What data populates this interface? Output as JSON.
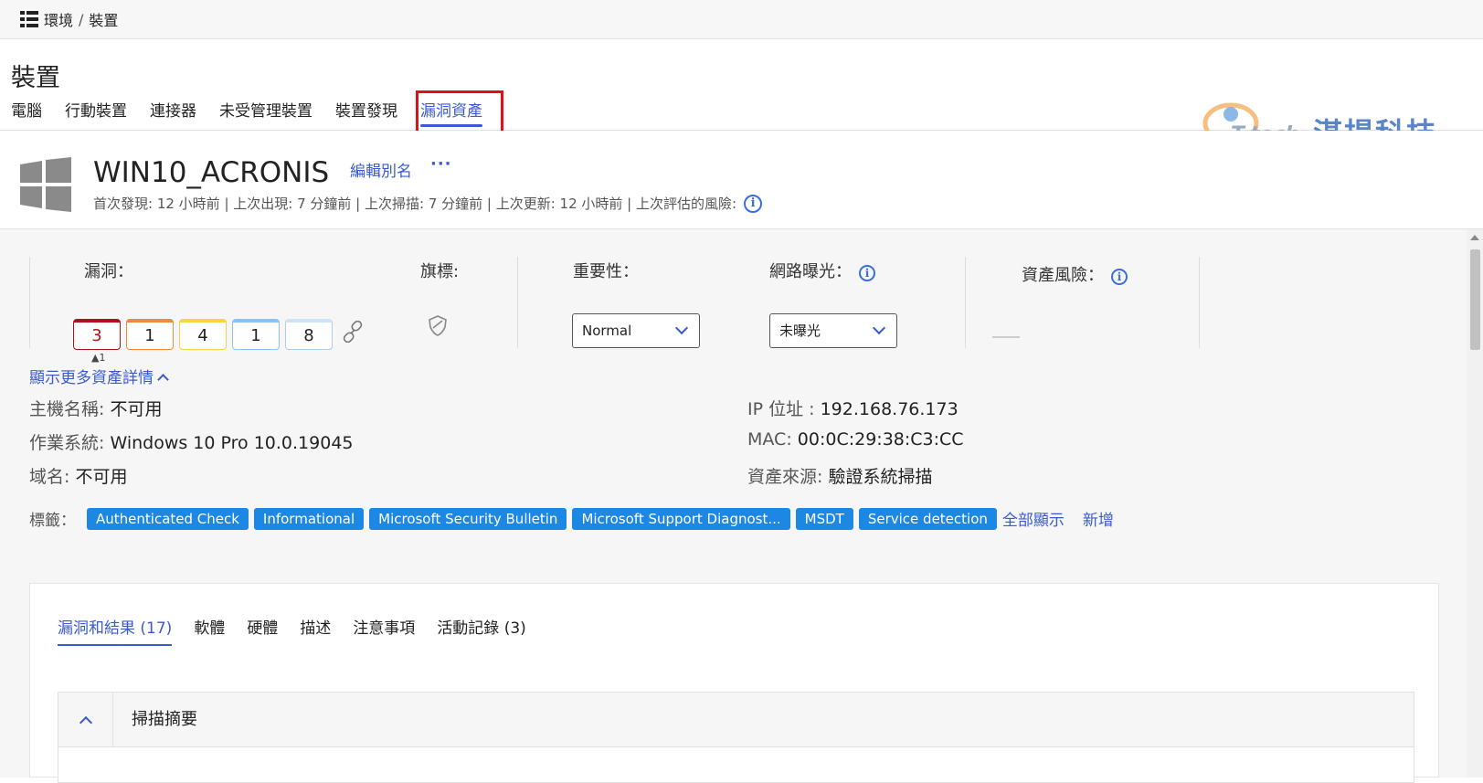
{
  "breadcrumb": {
    "root": "環境",
    "current": "裝置"
  },
  "page": {
    "title": "裝置"
  },
  "tabs": [
    {
      "label": "電腦"
    },
    {
      "label": "行動裝置"
    },
    {
      "label": "連接器"
    },
    {
      "label": "未受管理裝置"
    },
    {
      "label": "裝置發現"
    },
    {
      "label": "漏洞資產",
      "active": true
    }
  ],
  "logo": {
    "latin": "T-tech",
    "chinese": "湛揚科技"
  },
  "device": {
    "name": "WIN10_ACRONIS",
    "edit_alias": "編輯別名",
    "more": "···",
    "meta": "首次發現: 12 小時前 | 上次出現: 7 分鐘前 | 上次掃描: 7 分鐘前 | 上次更新: 12 小時前 | 上次評估的風險:"
  },
  "summary": {
    "vuln_label": "漏洞：",
    "severity_counts": {
      "s5": "3",
      "s4": "1",
      "s3": "4",
      "s2": "1",
      "s1": "8"
    },
    "trend": "▲1",
    "flags_label": "旗標:",
    "importance_label": "重要性：",
    "importance_value": "Normal",
    "exposure_label": "網路曝光：",
    "exposure_value": "未曝光",
    "risk_label": "資產風險："
  },
  "details": {
    "toggle": "顯示更多資產詳情",
    "hostname_key": "主機名稱:",
    "hostname_val": "不可用",
    "os_key": "作業系統:",
    "os_val": "Windows 10 Pro 10.0.19045",
    "domain_key": "域名:",
    "domain_val": "不可用",
    "ip_key": "IP 位址 :",
    "ip_val": "192.168.76.173",
    "mac_key": "MAC:",
    "mac_val": "00:0C:29:38:C3:CC",
    "source_key": "資產來源:",
    "source_val": "驗證系統掃描"
  },
  "tags": {
    "label": "標籤：",
    "items": [
      "Authenticated Check",
      "Informational",
      "Microsoft Security Bulletin",
      "Microsoft Support Diagnost...",
      "MSDT",
      "Service detection"
    ],
    "show_all": "全部顯示",
    "add": "新增"
  },
  "panel": {
    "tabs": [
      {
        "label": "漏洞和結果 (17)",
        "active": true
      },
      {
        "label": "軟體"
      },
      {
        "label": "硬體"
      },
      {
        "label": "描述"
      },
      {
        "label": "注意事項"
      },
      {
        "label": "活動記錄 (3)"
      }
    ],
    "scan_summary": "掃描摘要"
  },
  "colors": {
    "accent": "#3a5bd0",
    "tag": "#1d87e4",
    "highlight": "#e3101b"
  }
}
